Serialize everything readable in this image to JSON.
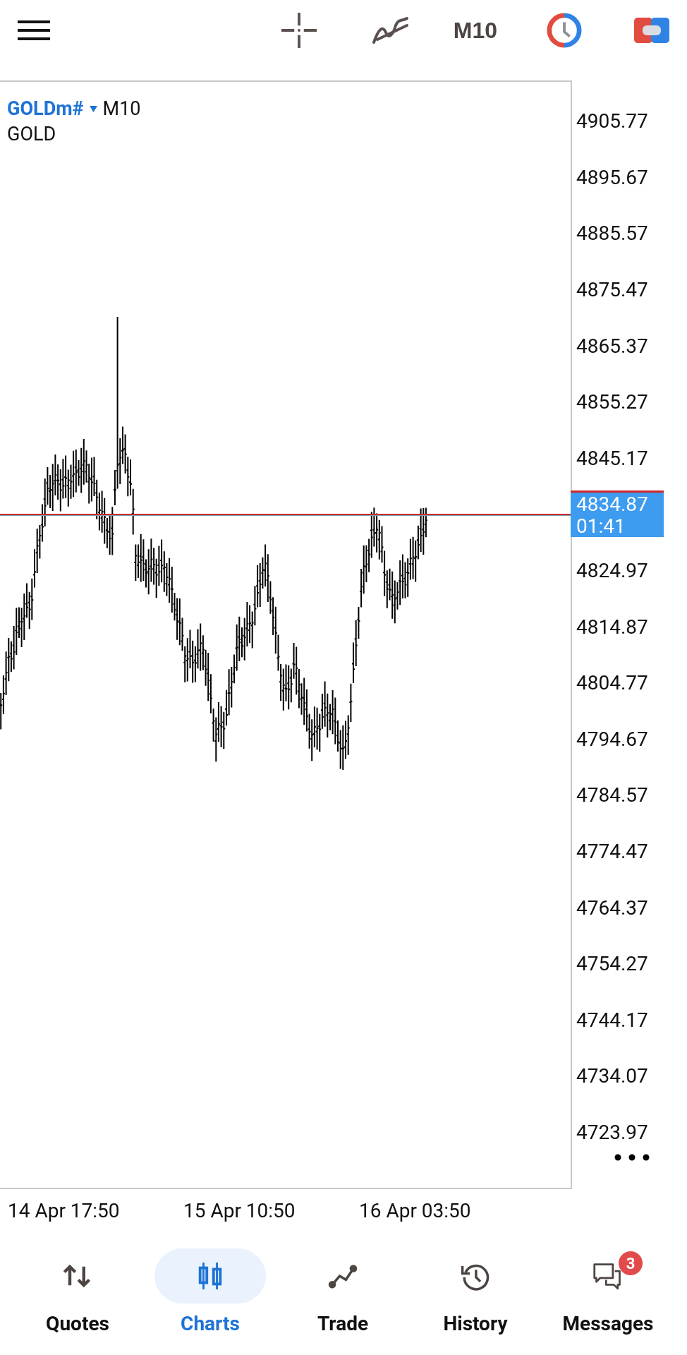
{
  "top_bar": {
    "timeframe": "M10"
  },
  "chart": {
    "symbol": "GOLDm#",
    "timeframe": "M10",
    "description": "GOLD",
    "price_levels": [
      "4905.77",
      "4895.67",
      "4885.57",
      "4875.47",
      "4865.37",
      "4855.27",
      "4845.17",
      "4824.97",
      "4814.87",
      "4804.77",
      "4794.67",
      "4784.57",
      "4774.47",
      "4764.37",
      "4754.27",
      "4744.17",
      "4734.07",
      "4723.97"
    ],
    "current_price": {
      "price": "4834.87",
      "countdown": "01:41"
    },
    "time_labels": [
      "14 Apr 17:50",
      "15 Apr 10:50",
      "16 Apr 03:50"
    ]
  },
  "nav": [
    {
      "label": "Quotes",
      "selected": false
    },
    {
      "label": "Charts",
      "selected": true
    },
    {
      "label": "Trade",
      "selected": false
    },
    {
      "label": "History",
      "selected": false
    },
    {
      "label": "Messages",
      "selected": false,
      "badge": "3"
    }
  ]
}
